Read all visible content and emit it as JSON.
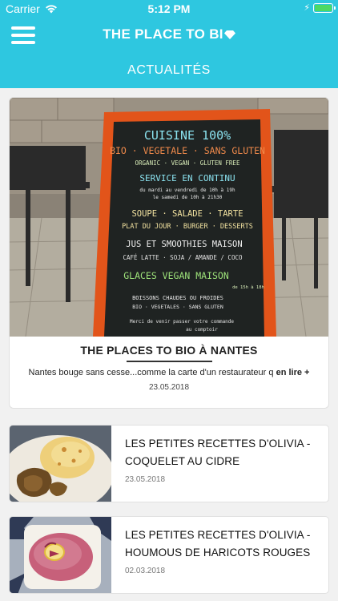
{
  "status_bar": {
    "carrier": "Carrier",
    "time": "5:12 PM"
  },
  "header": {
    "app_title": "THE PLACE TO BI",
    "section_title": "ACTUALITÉS"
  },
  "featured": {
    "title": "THE PLACES TO BIO À NANTES",
    "excerpt": "Nantes bouge sans cesse...comme la carte d'un restaurateur q",
    "read_more": "en lire +",
    "date": "23.05.2018",
    "chalkboard": {
      "lines": [
        "CUISINE 100%",
        "BIO · VEGETALE · SANS GLUTEN",
        "ORGANIC · VEGAN · GLUTEN FREE",
        "SERVICE EN CONTINU",
        "du mardi au vendredi de 10h à 19h",
        "le samedi de 10h à 21h30",
        "SOUPE · SALADE · TARTE",
        "PLAT DU JOUR · BURGER · DESSERTS",
        "JUS ET SMOOTHIES MAISON",
        "CAFÉ LATTE · SOJA / AMANDE / COCO",
        "GLACES VEGAN MAISON",
        "de 15h à 18h",
        "BOISSONS CHAUDES OU FROIDES",
        "BIO · VEGETALES · SANS GLUTEN",
        "Merci de venir passer votre commande",
        "au comptoir"
      ]
    }
  },
  "articles": [
    {
      "title_line1": "LES PETITES RECETTES D'OLIVIA -",
      "title_line2": "COQUELET AU CIDRE",
      "date": "23.05.2018"
    },
    {
      "title_line1": "LES PETITES RECETTES D'OLIVIA -",
      "title_line2": "HOUMOUS DE HARICOTS ROUGES",
      "date": "02.03.2018"
    }
  ],
  "colors": {
    "header": "#2ec7e0",
    "background": "#f1f1f1",
    "battery": "#4cd964",
    "chalkboard_frame": "#e2541a"
  },
  "icons": {
    "menu": "hamburger-menu-icon",
    "wifi": "wifi-icon",
    "battery": "battery-icon",
    "logo": "diamond-icon"
  }
}
